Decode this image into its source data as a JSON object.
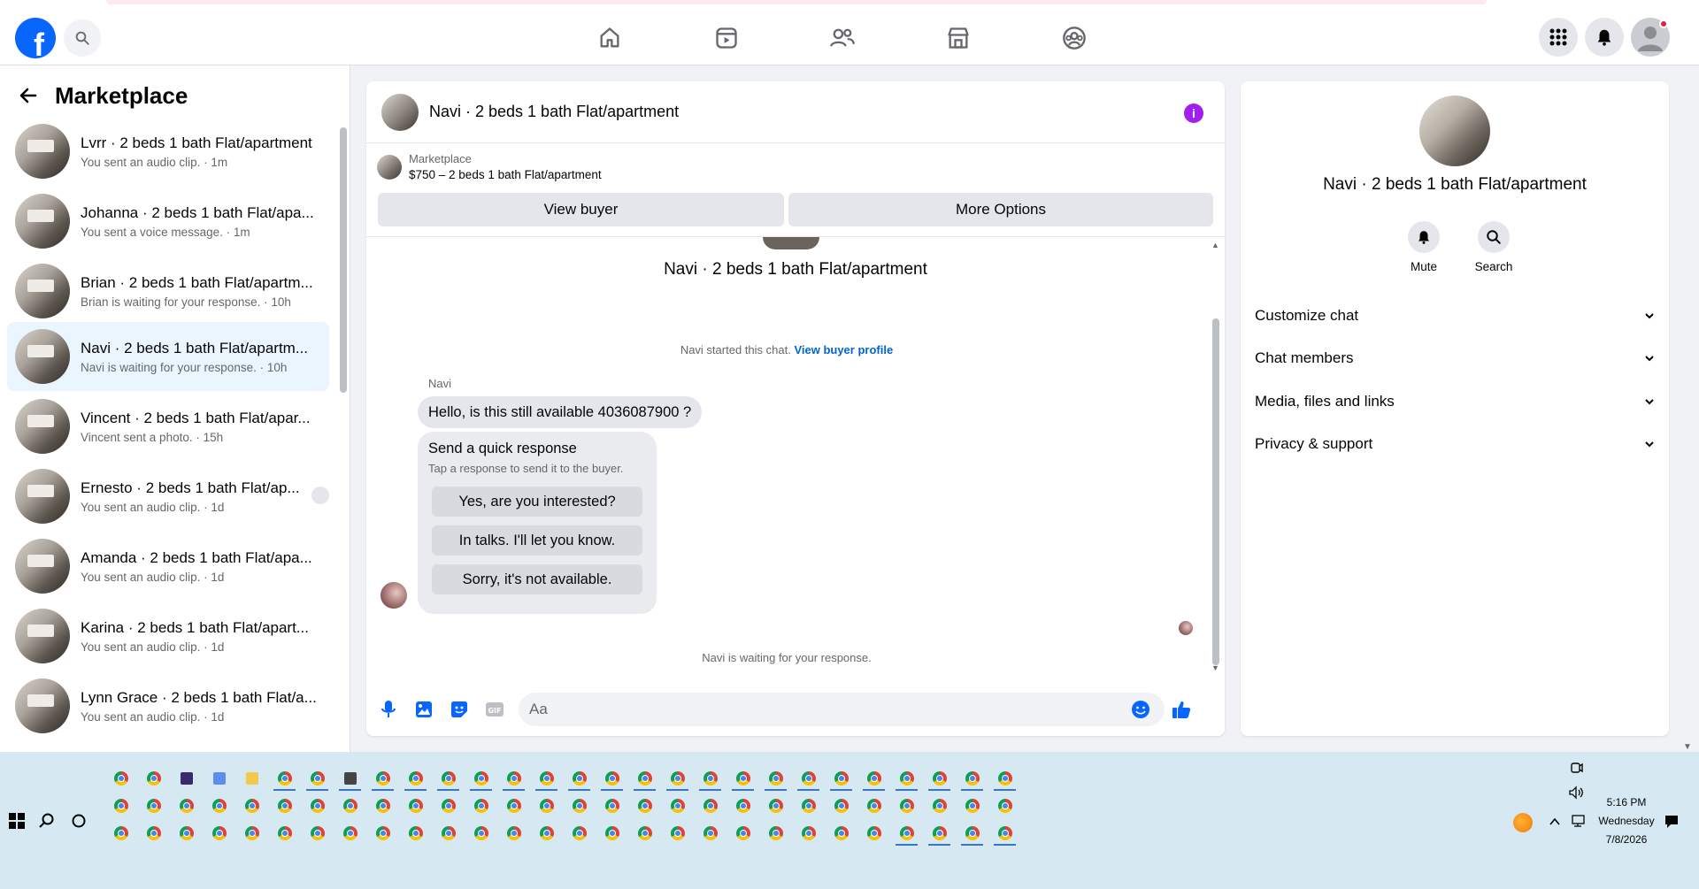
{
  "topnav": {
    "logo": "f",
    "icons": [
      "home-icon",
      "video-icon",
      "friends-icon",
      "marketplace-icon",
      "groups-icon"
    ]
  },
  "left": {
    "title": "Marketplace",
    "conversations": [
      {
        "name": "Lvrr · 2 beds 1 bath Flat/apartment",
        "sub": "You sent an audio clip. · 1m"
      },
      {
        "name": "Johanna · 2 beds 1 bath Flat/apa...",
        "sub": "You sent a voice message. · 1m"
      },
      {
        "name": "Brian · 2 beds 1 bath Flat/apartm...",
        "sub": "Brian is waiting for your response. · 10h"
      },
      {
        "name": "Navi · 2 beds 1 bath Flat/apartm...",
        "sub": "Navi is waiting for your response. · 10h"
      },
      {
        "name": "Vincent · 2 beds 1 bath Flat/apar...",
        "sub": "Vincent sent a photo. · 15h"
      },
      {
        "name": "Ernesto · 2 beds 1 bath Flat/ap...",
        "sub": "You sent an audio clip. · 1d"
      },
      {
        "name": "Amanda · 2 beds 1 bath Flat/apa...",
        "sub": "You sent an audio clip. · 1d"
      },
      {
        "name": "Karina · 2 beds 1 bath Flat/apart...",
        "sub": "You sent an audio clip. · 1d"
      },
      {
        "name": "Lynn Grace · 2 beds 1 bath Flat/a...",
        "sub": "You sent an audio clip. · 1d"
      }
    ]
  },
  "chat": {
    "title": "Navi · 2 beds 1 bath Flat/apartment",
    "marketplace_label": "Marketplace",
    "listing": "$750 – 2 beds 1 bath Flat/apartment",
    "view_buyer": "View buyer",
    "more_options": "More Options",
    "center_name": "Navi · 2 beds 1 bath Flat/apartment",
    "started_text": "Navi started this chat.",
    "view_buyer_profile": "View buyer profile",
    "sender": "Navi",
    "message": "Hello, is this still available 4036087900 ?",
    "quick_title": "Send a quick response",
    "quick_sub": "Tap a response to send it to the buyer.",
    "quick_responses": [
      "Yes, are you interested?",
      "In talks. I'll let you know.",
      "Sorry, it's not available."
    ],
    "waiting": "Navi is waiting for your response.",
    "input_placeholder": "Aa"
  },
  "right": {
    "name": "Navi · 2 beds 1 bath Flat/apartment",
    "mute": "Mute",
    "search": "Search",
    "sections": [
      "Customize chat",
      "Chat members",
      "Media, files and links",
      "Privacy & support"
    ]
  },
  "taskbar": {
    "time": "5:16 PM",
    "day": "Wednesday",
    "date": "7/8/2026"
  }
}
